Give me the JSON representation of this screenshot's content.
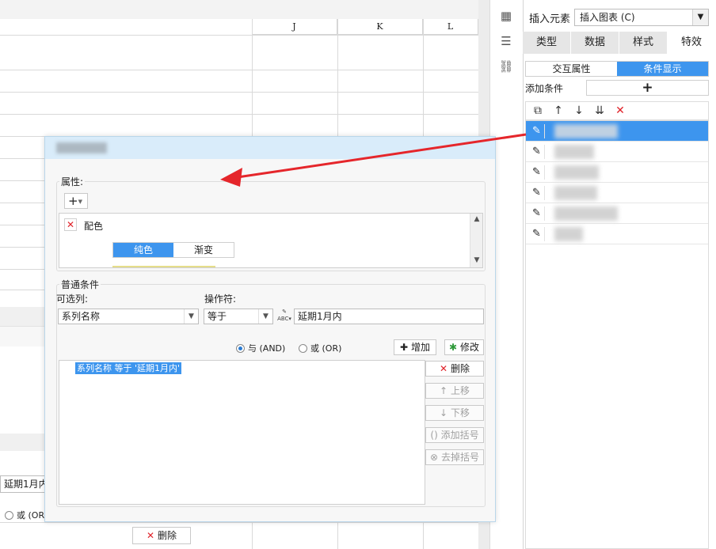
{
  "sheet": {
    "columns": [
      "J",
      "K",
      "L"
    ],
    "left_field_value": "延期1月内",
    "left_radio_label": "或 (OR",
    "bottom_delete_label": "删除"
  },
  "right_panel": {
    "insert_label": "插入元素",
    "insert_select_value": "插入图表 (C)",
    "tabs": [
      "类型",
      "数据",
      "样式",
      "特效"
    ],
    "active_tab": "特效",
    "subtabs": [
      "交互属性",
      "条件显示"
    ],
    "active_subtab": "条件显示",
    "add_condition_label": "添加条件",
    "add_condition_button": "+",
    "condition_rows": 6
  },
  "dialog": {
    "properties_label": "属性:",
    "add_property_button": "+",
    "property_name": "配色",
    "segments": [
      "纯色",
      "渐变"
    ],
    "active_segment": "纯色",
    "common_conditions_label": "普通条件",
    "optional_column_label": "可选列:",
    "optional_column_value": "系列名称",
    "operator_label": "操作符:",
    "operator_value": "等于",
    "value_field": "延期1月内",
    "and_label": "与 (AND)",
    "or_label": "或 (OR)",
    "add_button": "增加",
    "modify_button": "修改",
    "condition_text": "系列名称 等于 '延期1月内'",
    "side_buttons": {
      "delete": "删除",
      "move_up": "上移",
      "move_down": "下移",
      "add_paren": "添加括号",
      "remove_paren": "去掉括号"
    }
  },
  "colors": {
    "accent": "#3d95ee",
    "arrow": "#e5262b",
    "dialog_title_bg": "#d9ecfa"
  }
}
